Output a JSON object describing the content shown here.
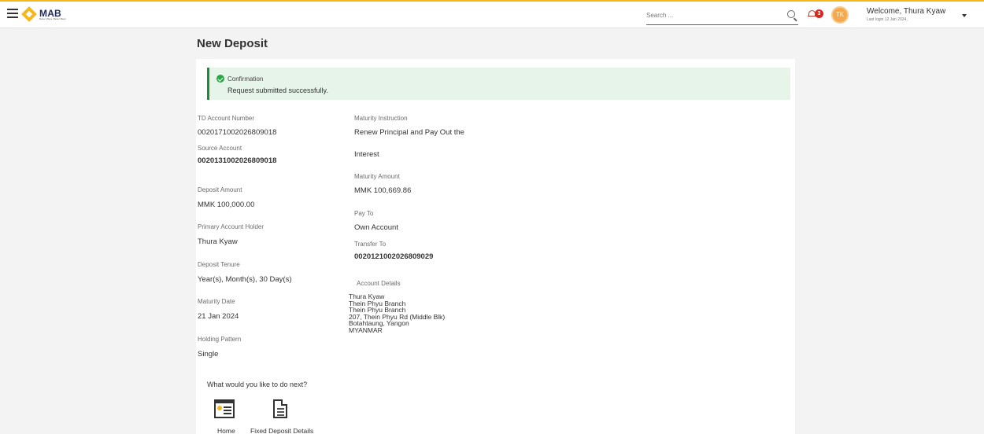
{
  "header": {
    "brand_name": "MAB",
    "brand_tagline": "Better Ways, Better Bank",
    "search_placeholder": "Search ...",
    "notification_count": "3",
    "avatar_initials": "TK",
    "welcome_text": "Welcome, Thura Kyaw",
    "last_login": "Last login 12 Jan 2024,",
    "colors": {
      "brand": "#f4b81c",
      "badge": "#d7281f"
    }
  },
  "page": {
    "title": "New Deposit"
  },
  "alert": {
    "title": "Confirmation",
    "message": "Request submitted successfully."
  },
  "details": {
    "td_account_label": "TD Account Number",
    "td_account_value": "0020171002026809018",
    "source_account_label": "Source Account",
    "source_account_value": "0020131002026809018",
    "deposit_amount_label": "Deposit Amount",
    "deposit_amount_value": "MMK 100,000.00",
    "primary_holder_label": "Primary Account Holder",
    "primary_holder_value": "Thura Kyaw",
    "deposit_tenure_label": "Deposit Tenure",
    "deposit_tenure_value": "Year(s), Month(s), 30 Day(s)",
    "maturity_date_label": "Maturity Date",
    "maturity_date_value": "21 Jan 2024",
    "holding_pattern_label": "Holding Pattern",
    "holding_pattern_value": "Single",
    "maturity_instruction_label": "Maturity Instruction",
    "maturity_instruction_line1": "Renew Principal and Pay Out the",
    "maturity_instruction_line2": "Interest",
    "maturity_amount_label": "Maturity Amount",
    "maturity_amount_value": "MMK 100,669.86",
    "pay_to_label": "Pay To",
    "pay_to_value": "Own Account",
    "transfer_to_label": "Transfer To",
    "transfer_to_value": "0020121002026809029",
    "account_details_label": "Account Details",
    "account_details_lines": [
      "Thura Kyaw",
      "Thein Phyu Branch",
      "Thein Phyu Branch",
      "207, Thein Phyu Rd (Middle Blk)",
      "Botahtaung, Yangon",
      "MYANMAR"
    ]
  },
  "next_steps": {
    "question": "What would you like to do next?",
    "home_label": "Home",
    "fd_details_label": "Fixed Deposit Details"
  }
}
